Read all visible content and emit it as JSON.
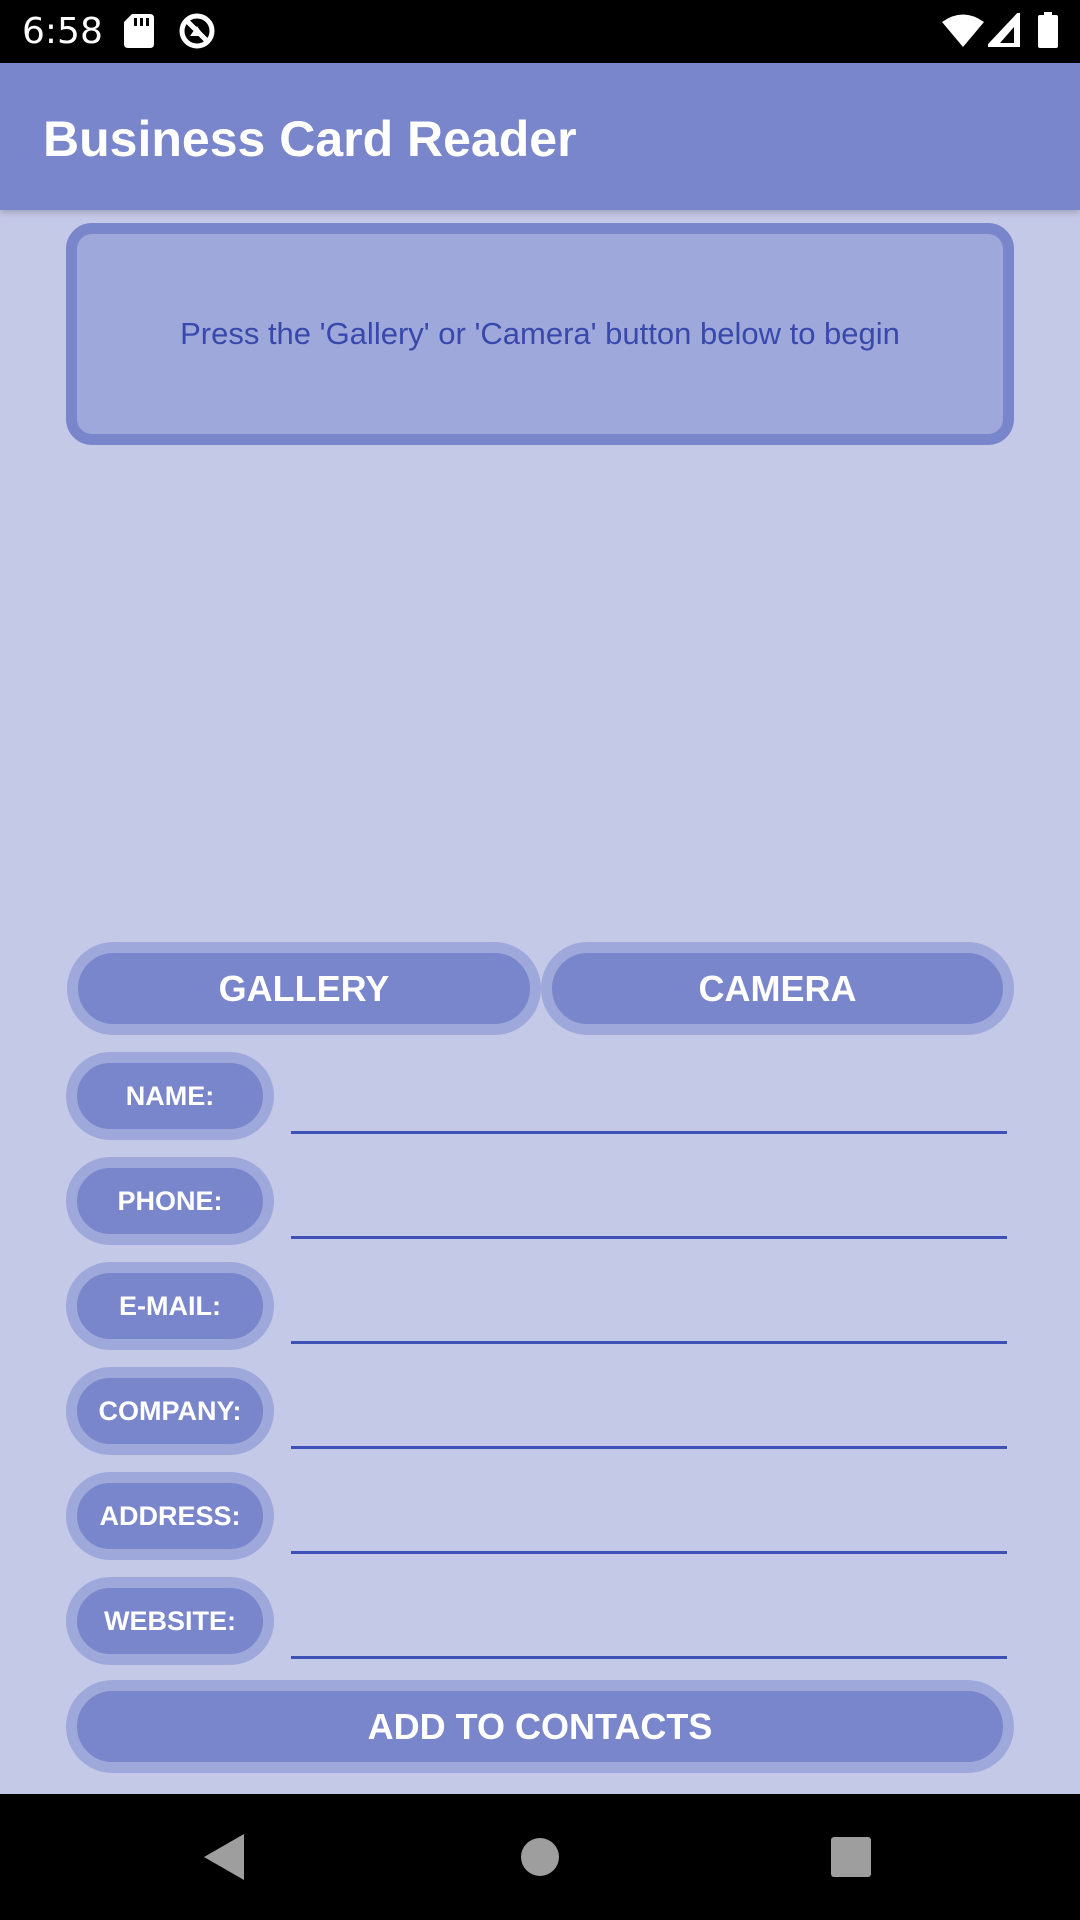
{
  "status_bar": {
    "time": "6:58",
    "icons": [
      "sd-card-icon",
      "sync-icon",
      "wifi-icon",
      "signal-icon",
      "battery-icon"
    ]
  },
  "app_bar": {
    "title": "Business Card Reader"
  },
  "info_panel": {
    "message": "Press the 'Gallery' or 'Camera' button below to begin"
  },
  "actions": {
    "gallery_label": "GALLERY",
    "camera_label": "CAMERA",
    "add_contacts_label": "ADD TO CONTACTS"
  },
  "fields": [
    {
      "label": "NAME:",
      "value": ""
    },
    {
      "label": "PHONE:",
      "value": ""
    },
    {
      "label": "E-MAIL:",
      "value": ""
    },
    {
      "label": "COMPANY:",
      "value": ""
    },
    {
      "label": "ADDRESS:",
      "value": ""
    },
    {
      "label": "WEBSITE:",
      "value": ""
    }
  ],
  "nav_bar": {
    "icons": [
      "back-icon",
      "home-icon",
      "recents-icon"
    ]
  },
  "colors": {
    "background": "#c5c9e8",
    "primary": "#7986cb",
    "primary_light": "#9fa8da",
    "accent_text": "#3949ab",
    "underline": "#3f51b5"
  }
}
